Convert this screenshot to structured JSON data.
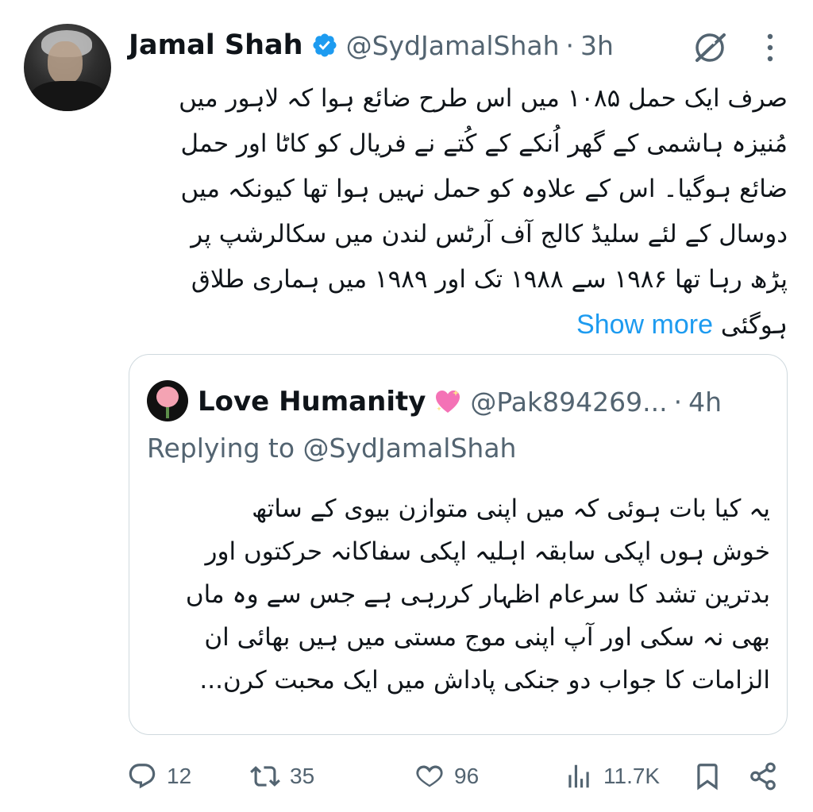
{
  "author": {
    "name": "Jamal Shah",
    "handle": "@SydJamalShah",
    "dot": "·",
    "time": "3h"
  },
  "tweet": {
    "lines": [
      "صرف ایک حمل ۱۰۸۵ میں اس طرح ضائع ہوا کہ لاہور میں",
      "مُنیزہ ہاشمی کے گھر اُنکے کے کُتے نے فریال کو کاٹا اور حمل",
      "ضائع ہوگیا۔ اس کے علاوہ کو حمل نہیں ہوا تھا کیونکہ میں",
      "دوسال کے لئے سلیڈ کالج آف آرٹس لندن میں سکالرشپ پر",
      "پڑھ رہا تھا ۱۹۸۶ سے ۱۹۸۸ تک اور ۱۹۸۹ میں ہماری طلاق",
      "ہوگئی"
    ],
    "show_more": "Show more"
  },
  "quote": {
    "name": "Love Humanity",
    "handle": "@Pak894269...",
    "dot": "·",
    "time": "4h",
    "replying_prefix": "Replying to",
    "replying_handle": "@SydJamalShah",
    "lines": [
      "یہ کیا بات ہوئی کہ میں اپنی متوازن بیوی کے ساتھ",
      "خوش ہوں اپکی سابقہ اہلیہ اپکی سفاکانہ حرکتوں اور",
      "بدترین تشد کا سرعام اظہار کررہی ہے جس سے وہ ماں",
      "بھی نہ سکی اور آپ اپنی موج مستی میں ہیں بھائی ان",
      "الزامات کا جواب دو جنکی پاداش میں ایک محبت کرن..."
    ]
  },
  "actions": {
    "replies": "12",
    "retweets": "35",
    "likes": "96",
    "views": "11.7K"
  },
  "colors": {
    "text": "#0f1419",
    "secondary": "#536471",
    "link": "#1d9bf0",
    "verified": "#1d9bf0",
    "border": "#cfd9de"
  },
  "icons": {
    "verified": "verified-badge-icon",
    "grok": "grok-icon",
    "more": "more-options-icon",
    "reply": "reply-icon",
    "retweet": "retweet-icon",
    "like": "heart-icon",
    "views": "views-icon",
    "bookmark": "bookmark-icon",
    "share": "share-icon"
  }
}
